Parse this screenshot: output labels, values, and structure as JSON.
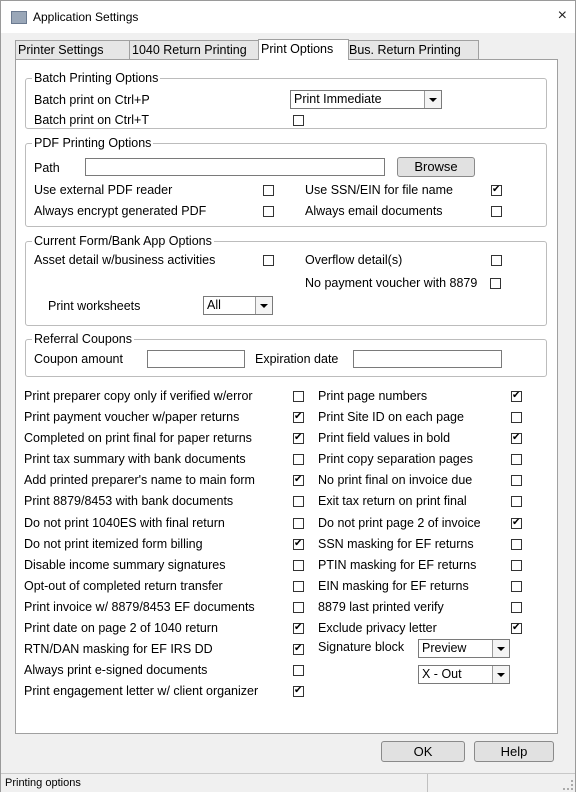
{
  "window": {
    "title": "Application Settings",
    "close_label": "×"
  },
  "tabs": [
    {
      "label": "Printer Settings"
    },
    {
      "label": "1040 Return Printing"
    },
    {
      "label": "Print Options"
    },
    {
      "label": "Bus. Return Printing"
    }
  ],
  "active_tab": "Print Options",
  "batch": {
    "title": "Batch Printing Options",
    "ctrl_p_label": "Batch print on Ctrl+P",
    "ctrl_p_value": "Print Immediate",
    "ctrl_t_label": "Batch print on Ctrl+T",
    "ctrl_t_checked": false
  },
  "pdf": {
    "title": "PDF Printing Options",
    "path_label": "Path",
    "path_value": "",
    "browse_label": "Browse",
    "options": [
      {
        "label": "Use external PDF reader",
        "checked": false
      },
      {
        "label": "Use SSN/EIN for file name",
        "checked": true
      },
      {
        "label": "Always encrypt generated PDF",
        "checked": false
      },
      {
        "label": "Always email documents",
        "checked": false
      }
    ]
  },
  "current_form": {
    "title": "Current Form/Bank App Options",
    "asset_label": "Asset detail w/business activities",
    "asset_checked": false,
    "overflow_label": "Overflow detail(s)",
    "overflow_checked": false,
    "novoucher_label": "No payment voucher with 8879",
    "novoucher_checked": false,
    "worksheets_label": "Print worksheets",
    "worksheets_value": "All"
  },
  "referral": {
    "title": "Referral Coupons",
    "amount_label": "Coupon amount",
    "amount_value": "",
    "expiration_label": "Expiration date",
    "expiration_value": ""
  },
  "left_options": [
    {
      "label": "Print preparer copy only if verified w/error",
      "checked": false
    },
    {
      "label": "Print payment voucher w/paper returns",
      "checked": true
    },
    {
      "label": "Completed on print final for paper returns",
      "checked": true
    },
    {
      "label": "Print tax summary with bank documents",
      "checked": false
    },
    {
      "label": "Add printed preparer's name to main form",
      "checked": true
    },
    {
      "label": "Print 8879/8453 with bank documents",
      "checked": false
    },
    {
      "label": "Do not print 1040ES with final return",
      "checked": false
    },
    {
      "label": "Do not print itemized form billing",
      "checked": true
    },
    {
      "label": "Disable income summary signatures",
      "checked": false
    },
    {
      "label": "Opt-out of completed return transfer",
      "checked": false
    },
    {
      "label": "Print invoice w/ 8879/8453 EF documents",
      "checked": false
    },
    {
      "label": "Print date on page 2 of 1040 return",
      "checked": true
    },
    {
      "label": "RTN/DAN masking for EF IRS DD",
      "checked": true
    },
    {
      "label": "Always print e-signed documents",
      "checked": false
    },
    {
      "label": "Print engagement letter w/ client organizer",
      "checked": true
    }
  ],
  "right_options": [
    {
      "label": "Print page numbers",
      "checked": true
    },
    {
      "label": "Print Site ID on each page",
      "checked": false
    },
    {
      "label": "Print field values in bold",
      "checked": true
    },
    {
      "label": "Print copy separation pages",
      "checked": false
    },
    {
      "label": "No print final on invoice due",
      "checked": false
    },
    {
      "label": "Exit tax return on print final",
      "checked": false
    },
    {
      "label": "Do not print page 2 of invoice",
      "checked": true
    },
    {
      "label": "SSN masking for EF returns",
      "checked": false
    },
    {
      "label": "PTIN masking for EF returns",
      "checked": false
    },
    {
      "label": "EIN masking for EF returns",
      "checked": false
    },
    {
      "label": "8879 last printed verify",
      "checked": false
    },
    {
      "label": "Exclude privacy letter",
      "checked": true
    }
  ],
  "signature": {
    "label": "Signature block",
    "value": "Preview",
    "value2": "X - Out"
  },
  "buttons": {
    "ok": "OK",
    "help": "Help"
  },
  "status": {
    "text": "Printing options"
  },
  "icons": {
    "window": "window-icon",
    "close": "close-icon",
    "dropdown": "chevron-down-icon",
    "check": "checkmark-icon"
  }
}
